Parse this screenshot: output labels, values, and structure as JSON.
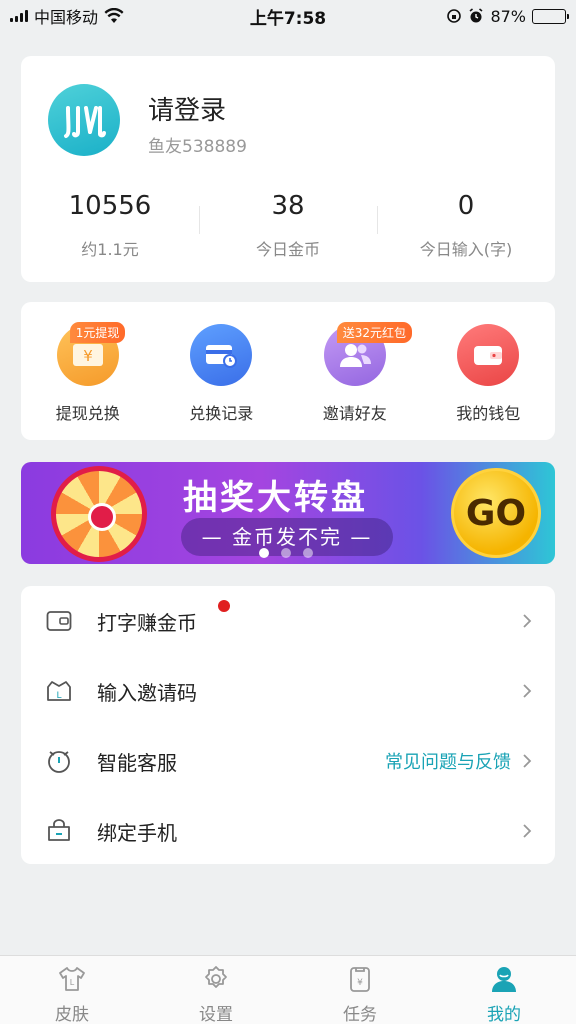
{
  "status_bar": {
    "carrier": "中国移动",
    "time": "上午7:58",
    "battery": "87%",
    "battery_level": 0.87
  },
  "profile": {
    "title": "请登录",
    "user_id": "鱼友538889",
    "stats": [
      {
        "value": "10556",
        "label": "约1.1元"
      },
      {
        "value": "38",
        "label": "今日金币"
      },
      {
        "value": "0",
        "label": "今日输入(字)"
      }
    ]
  },
  "actions": [
    {
      "label": "提现兑换",
      "tag": "1元提现",
      "icon": "ticket-icon",
      "color": "#f7a93b"
    },
    {
      "label": "兑换记录",
      "tag": "",
      "icon": "card-clock-icon",
      "color": "#3f7ff2"
    },
    {
      "label": "邀请好友",
      "tag": "送32元红包",
      "icon": "people-icon",
      "color": "#a57be9"
    },
    {
      "label": "我的钱包",
      "tag": "",
      "icon": "wallet-icon",
      "color": "#f25757"
    }
  ],
  "banner": {
    "title": "抽奖大转盘",
    "subtitle": "— 金币发不完 —",
    "go_label": "GO",
    "active_dot": 0,
    "dot_count": 3
  },
  "menu": [
    {
      "label": "打字赚金币",
      "icon": "wallet-outline-icon",
      "has_badge": true,
      "extra": ""
    },
    {
      "label": "输入邀请码",
      "icon": "basket-icon",
      "has_badge": false,
      "extra": ""
    },
    {
      "label": "智能客服",
      "icon": "clock-icon",
      "has_badge": false,
      "extra": "常见问题与反馈"
    },
    {
      "label": "绑定手机",
      "icon": "bag-icon",
      "has_badge": false,
      "extra": ""
    }
  ],
  "tabbar": {
    "active": 3,
    "items": [
      {
        "label": "皮肤",
        "icon": "shirt-icon"
      },
      {
        "label": "设置",
        "icon": "gear-icon"
      },
      {
        "label": "任务",
        "icon": "task-icon"
      },
      {
        "label": "我的",
        "icon": "person-icon"
      }
    ]
  },
  "colors": {
    "accent": "#1aa3b5",
    "badge_red": "#e02020",
    "banner_purple": "#8b3be0"
  }
}
